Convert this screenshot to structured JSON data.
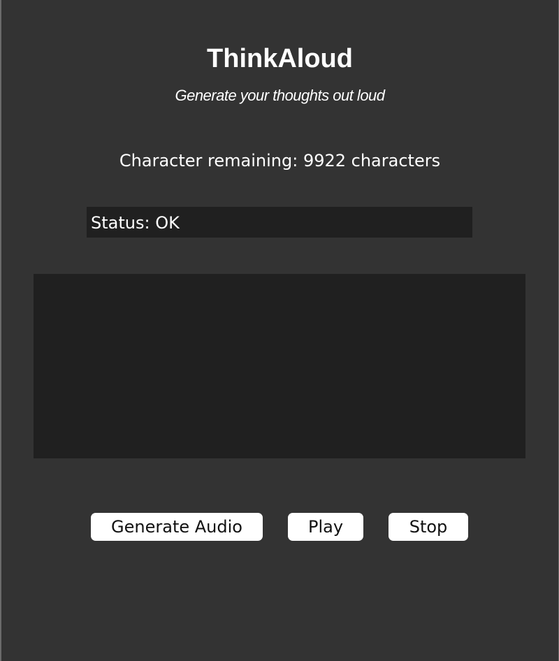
{
  "app": {
    "title": "ThinkAloud",
    "subtitle": "Generate your thoughts out loud"
  },
  "counter": {
    "text": "Character remaining: 9922 characters",
    "remaining": 9922
  },
  "status": {
    "text": "Status: OK"
  },
  "input": {
    "value": ""
  },
  "buttons": {
    "generate_label": "Generate Audio",
    "play_label": "Play",
    "stop_label": "Stop"
  },
  "colors": {
    "background": "#333333",
    "panel": "#202020",
    "button": "#ffffff",
    "text": "#ffffff"
  }
}
